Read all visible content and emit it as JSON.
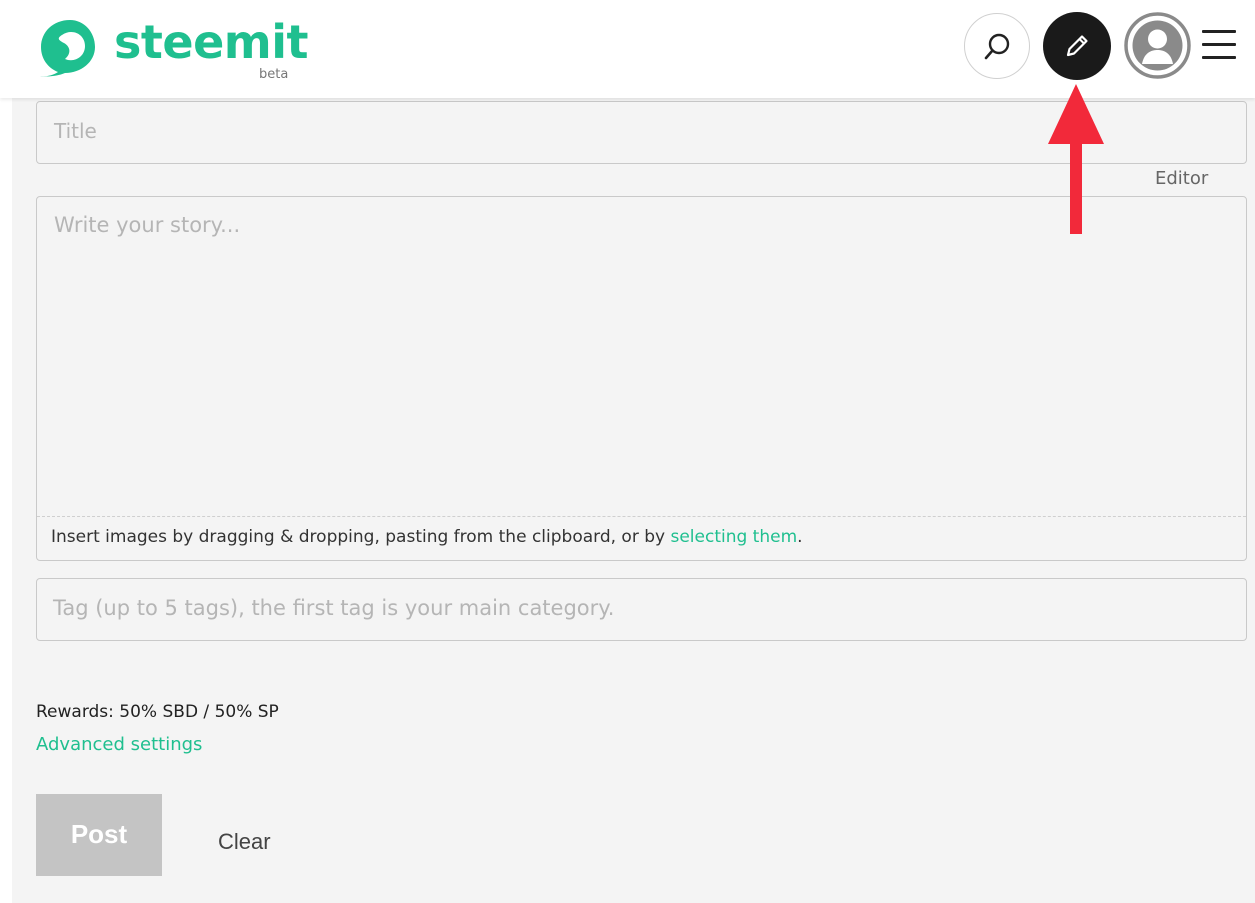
{
  "header": {
    "logo_text": "steemit",
    "logo_badge": "beta",
    "brand_color": "#1fbf8f",
    "icons": [
      "steemit-logo-icon",
      "search-icon",
      "pencil-icon",
      "avatar-icon",
      "hamburger-menu-icon"
    ]
  },
  "editor": {
    "title_placeholder": "Title",
    "editor_toggle_label": "Editor",
    "body_placeholder": "Write your story...",
    "dropzone_text": "Insert images by dragging & dropping, pasting from the clipboard, or by ",
    "dropzone_link": "selecting them",
    "dropzone_period": ".",
    "tags_placeholder": "Tag (up to 5 tags), the first tag is your main category."
  },
  "settings": {
    "rewards_text": "Rewards: 50% SBD / 50% SP",
    "advanced_label": "Advanced settings"
  },
  "actions": {
    "post_label": "Post",
    "clear_label": "Clear"
  },
  "annotation": {
    "arrow_color": "#f2293a"
  }
}
